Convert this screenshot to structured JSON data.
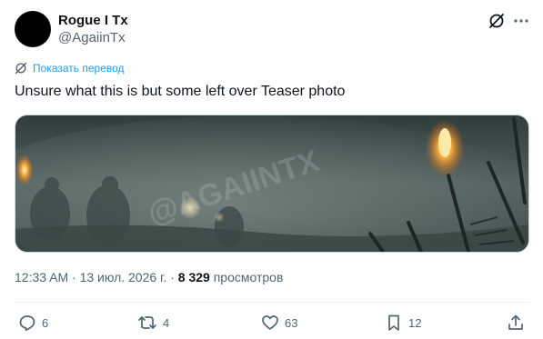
{
  "author": {
    "name": "Rogue I Tx",
    "handle": "@AgaiinTx"
  },
  "translate": {
    "label": "Показать перевод"
  },
  "tweet": {
    "text": "Unsure what this is but some left over Teaser photo"
  },
  "media": {
    "watermark": "@AGAIINTX"
  },
  "meta": {
    "timestamp": "12:33 AM · 13 июл. 2026 г. · ",
    "views_count": "8 329",
    "views_label": " просмотров"
  },
  "actions": {
    "replies": "6",
    "reposts": "4",
    "likes": "63",
    "bookmarks": "12"
  },
  "colors": {
    "accent": "#1d9bf0",
    "secondary_text": "#536471",
    "primary_text": "#0f1419"
  }
}
